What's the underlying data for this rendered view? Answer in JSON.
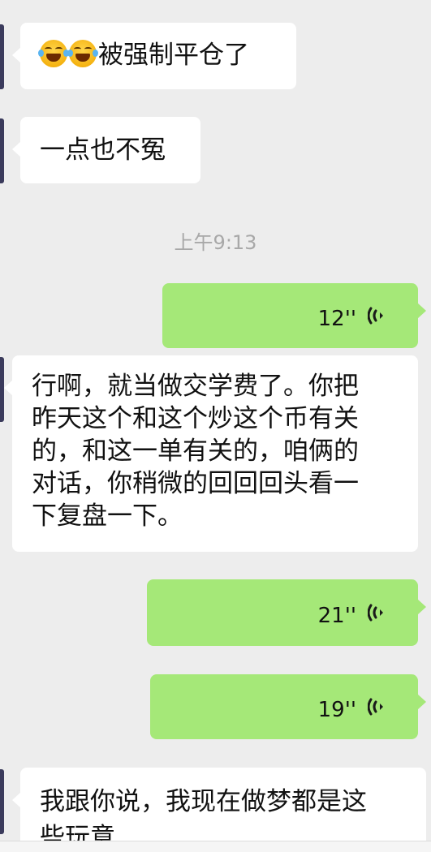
{
  "messages": [
    {
      "type": "incoming",
      "emoji": "face-with-tears-of-joy",
      "text": "被强制平仓了"
    },
    {
      "type": "incoming",
      "text": "一点也不冤"
    },
    {
      "type": "timestamp",
      "text": "上午9:13"
    },
    {
      "type": "outgoing-voice",
      "duration": "12''"
    },
    {
      "type": "incoming",
      "lines": [
        "行啊，就当做交学费了。你把",
        "昨天这个和这个炒这个币有关",
        "的，和这一单有关的，咱俩的",
        "对话，你稍微的回回回头看一",
        "下复盘一下。"
      ]
    },
    {
      "type": "outgoing-voice",
      "duration": "21''"
    },
    {
      "type": "outgoing-voice",
      "duration": "19''"
    },
    {
      "type": "incoming",
      "lines": [
        "我跟你说，我现在做梦都是这",
        "些玩意"
      ]
    }
  ],
  "colors": {
    "background": "#ededed",
    "incoming_bubble": "#ffffff",
    "outgoing_bubble": "#a5e878",
    "timestamp_text": "#a8a8a8"
  }
}
